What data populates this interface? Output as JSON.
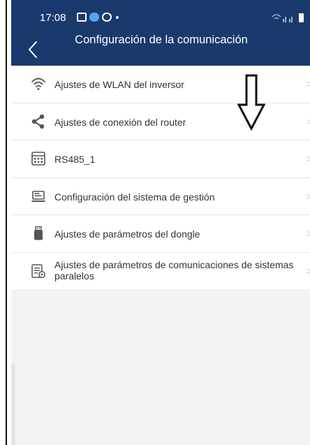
{
  "status_bar": {
    "time": "17:08"
  },
  "header": {
    "title": "Configuración de la comunicación"
  },
  "menu": {
    "items": [
      {
        "label": "Ajustes de WLAN del inversor",
        "icon": "wifi-icon"
      },
      {
        "label": "Ajustes de conexión del router",
        "icon": "share-icon"
      },
      {
        "label": "RS485_1",
        "icon": "rs485-port-icon"
      },
      {
        "label": "Configuración del sistema de gestión",
        "icon": "laptop-icon"
      },
      {
        "label": "Ajustes de parámetros del dongle",
        "icon": "dongle-icon"
      },
      {
        "label": "Ajustes de parámetros de comunicaciones de sistemas paralelos",
        "icon": "parallel-systems-icon"
      }
    ],
    "chevron": ">"
  },
  "colors": {
    "header_bg": "#1a3a6e",
    "icon_color": "#555555",
    "background": "#f2f2f2"
  }
}
